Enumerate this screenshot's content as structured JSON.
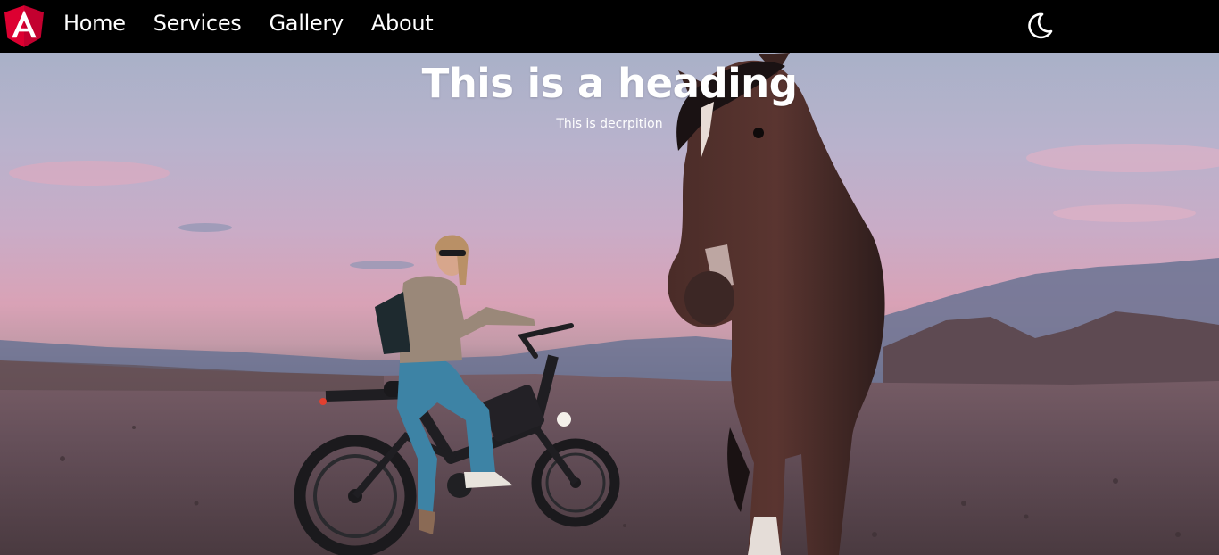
{
  "nav": {
    "links": [
      "Home",
      "Services",
      "Gallery",
      "About"
    ],
    "logo_icon": "angular-logo-icon",
    "theme_icon": "moon-icon"
  },
  "hero": {
    "heading": "This is a heading",
    "description": "This is decrpition",
    "image": "woman-on-ebike-with-horse-at-dusk"
  },
  "colors": {
    "navbar_bg": "#000000",
    "logo_red": "#dd0031",
    "logo_dark_red": "#c3002f",
    "text": "#ffffff"
  }
}
